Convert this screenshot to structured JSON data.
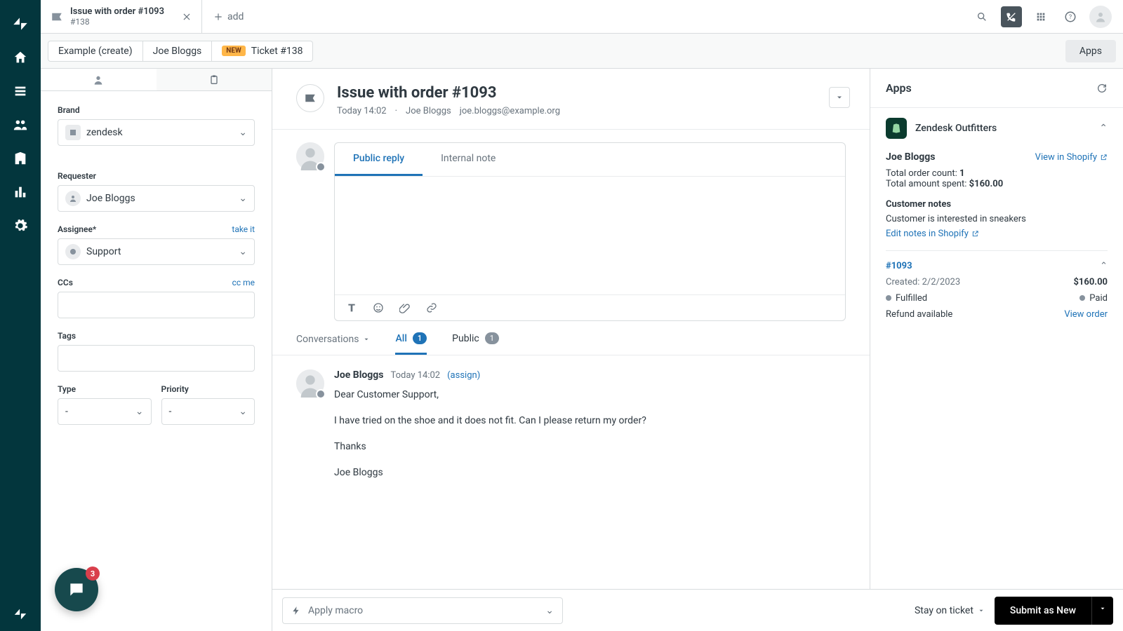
{
  "tab": {
    "title": "Issue with order #1093",
    "sub": "#138",
    "add": "add"
  },
  "crumbs": {
    "example": "Example (create)",
    "user": "Joe Bloggs",
    "new": "New",
    "ticket": "Ticket #138",
    "apps": "Apps"
  },
  "form": {
    "brand_label": "Brand",
    "brand_value": "zendesk",
    "requester_label": "Requester",
    "requester_value": "Joe Bloggs",
    "assignee_label": "Assignee*",
    "assignee_link": "take it",
    "assignee_value": "Support",
    "ccs_label": "CCs",
    "ccs_link": "cc me",
    "tags_label": "Tags",
    "type_label": "Type",
    "type_value": "-",
    "priority_label": "Priority",
    "priority_value": "-"
  },
  "ticket": {
    "title": "Issue with order #1093",
    "meta_time": "Today 14:02",
    "meta_sep": "·",
    "meta_user": "Joe Bloggs",
    "meta_email": "joe.bloggs@example.org"
  },
  "reply_tabs": {
    "public": "Public reply",
    "internal": "Internal note"
  },
  "filters": {
    "conversations": "Conversations",
    "all": "All",
    "all_count": "1",
    "public": "Public",
    "public_count": "1"
  },
  "msg": {
    "author": "Joe Bloggs",
    "time": "Today 14:02",
    "assign": "(assign)",
    "p1": "Dear Customer Support,",
    "p2": "I have tried on the shoe and it does not fit. Can I please return my order?",
    "p3": "Thanks",
    "p4": "Joe Bloggs"
  },
  "bottom": {
    "macro": "Apply macro",
    "stay": "Stay on ticket",
    "submit": "Submit as New"
  },
  "apps": {
    "heading": "Apps",
    "app_name": "Zendesk Outfitters",
    "customer": "Joe Bloggs",
    "view_link": "View in Shopify",
    "count_label": "Total order count: ",
    "count_value": "1",
    "spent_label": "Total amount spent: ",
    "spent_value": "$160.00",
    "notes_h": "Customer notes",
    "notes_body": "Customer is interested in sneakers",
    "edit_notes": "Edit notes in Shopify",
    "order_id": "#1093",
    "created_label": "Created: ",
    "created_value": "2/2/2023",
    "order_total": "$160.00",
    "fulfilled": "Fulfilled",
    "paid": "Paid",
    "refund": "Refund available",
    "view_order": "View order"
  },
  "chat_badge": "3"
}
